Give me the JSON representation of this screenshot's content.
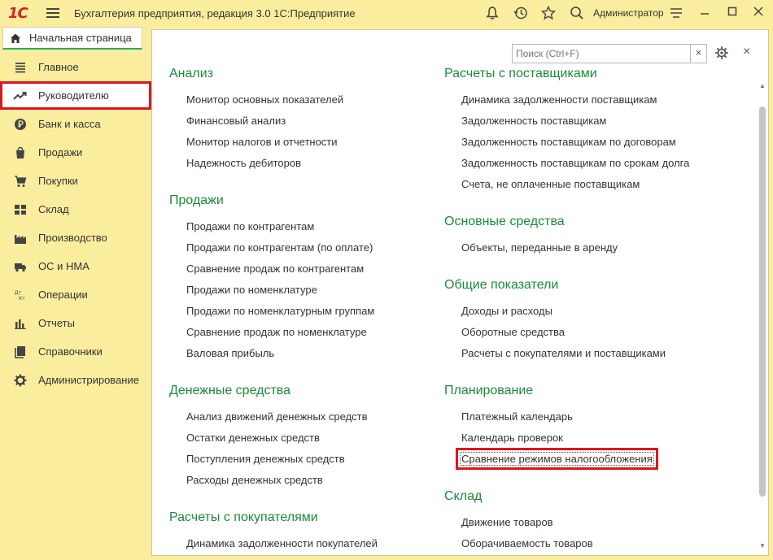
{
  "titlebar": {
    "logo": "1С",
    "title": "Бухгалтерия предприятия, редакция 3.0 1С:Предприятие",
    "user": "Администратор",
    "icons": [
      "bell-icon",
      "history-icon",
      "star-icon",
      "search-icon",
      "settings-lines-icon",
      "minimize-icon",
      "maximize-icon",
      "close-icon"
    ]
  },
  "home_tab": {
    "label": "Начальная страница"
  },
  "sidebar": {
    "items": [
      {
        "label": "Главное",
        "icon": "menu-lines-icon"
      },
      {
        "label": "Руководителю",
        "icon": "trend-up-icon"
      },
      {
        "label": "Банк и касса",
        "icon": "ruble-coin-icon"
      },
      {
        "label": "Продажи",
        "icon": "shopping-bag-icon"
      },
      {
        "label": "Покупки",
        "icon": "cart-icon"
      },
      {
        "label": "Склад",
        "icon": "warehouse-grid-icon"
      },
      {
        "label": "Производство",
        "icon": "factory-icon"
      },
      {
        "label": "ОС и НМА",
        "icon": "truck-icon"
      },
      {
        "label": "Операции",
        "icon": "dt-kt-icon"
      },
      {
        "label": "Отчеты",
        "icon": "bar-chart-icon"
      },
      {
        "label": "Справочники",
        "icon": "books-icon"
      },
      {
        "label": "Администрирование",
        "icon": "gear-icon"
      }
    ],
    "active_index": 1
  },
  "main": {
    "search_placeholder": "Поиск (Ctrl+F)",
    "clear_label": "×",
    "close_label": "×",
    "left_sections": [
      {
        "title": "Анализ",
        "links": [
          "Монитор основных показателей",
          "Финансовый анализ",
          "Монитор налогов и отчетности",
          "Надежность дебиторов"
        ]
      },
      {
        "title": "Продажи",
        "links": [
          "Продажи по контрагентам",
          "Продажи по контрагентам (по оплате)",
          "Сравнение продаж по контрагентам",
          "Продажи по номенклатуре",
          "Продажи по номенклатурным группам",
          "Сравнение продаж по номенклатуре",
          "Валовая прибыль"
        ]
      },
      {
        "title": "Денежные средства",
        "links": [
          "Анализ движений денежных средств",
          "Остатки денежных средств",
          "Поступления денежных средств",
          "Расходы денежных средств"
        ]
      },
      {
        "title": "Расчеты с покупателями",
        "links": [
          "Динамика задолженности покупателей"
        ]
      }
    ],
    "right_sections": [
      {
        "title": "Расчеты с поставщиками",
        "links": [
          "Динамика задолженности поставщикам",
          "Задолженность поставщикам",
          "Задолженность поставщикам по договорам",
          "Задолженность поставщикам по срокам долга",
          "Счета, не оплаченные поставщикам"
        ]
      },
      {
        "title": "Основные средства",
        "links": [
          "Объекты, переданные в аренду"
        ]
      },
      {
        "title": "Общие показатели",
        "links": [
          "Доходы и расходы",
          "Оборотные средства",
          "Расчеты с покупателями и поставщиками"
        ]
      },
      {
        "title": "Планирование",
        "links": [
          "Платежный календарь",
          "Календарь проверок",
          "Сравнение режимов налогообложения"
        ]
      },
      {
        "title": "Склад",
        "links": [
          "Движение товаров",
          "Оборачиваемость товаров"
        ]
      }
    ],
    "highlighted_link": "Сравнение режимов налогообложения"
  },
  "colors": {
    "background": "#fbed9e",
    "section_title": "#1b8a3a",
    "highlight": "#e0141e",
    "logo": "#d42322"
  }
}
